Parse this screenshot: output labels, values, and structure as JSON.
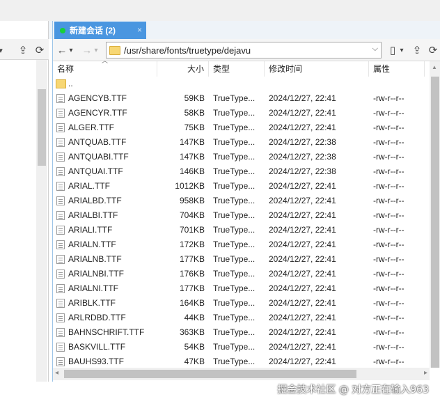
{
  "tab": {
    "label": "新建会话 (2)",
    "close": "×"
  },
  "toolbar": {
    "back": "←",
    "back_dd": "▾",
    "forward": "→",
    "forward_dd": "▾",
    "path": "/usr/share/fonts/truetype/dejavu",
    "bookmark": "▯",
    "up": "⇪",
    "refresh": "⟳"
  },
  "left_toolbar": {
    "item1": "⇪",
    "item2": "⟳"
  },
  "columns": {
    "name": "名称",
    "size": "大小",
    "type": "类型",
    "modified": "修改时间",
    "attrs": "属性"
  },
  "parent": {
    "name": ".."
  },
  "files": [
    {
      "name": "AGENCYB.TTF",
      "size": "59KB",
      "type": "TrueType...",
      "modified": "2024/12/27, 22:41",
      "attrs": "-rw-r--r--"
    },
    {
      "name": "AGENCYR.TTF",
      "size": "58KB",
      "type": "TrueType...",
      "modified": "2024/12/27, 22:41",
      "attrs": "-rw-r--r--"
    },
    {
      "name": "ALGER.TTF",
      "size": "75KB",
      "type": "TrueType...",
      "modified": "2024/12/27, 22:41",
      "attrs": "-rw-r--r--"
    },
    {
      "name": "ANTQUAB.TTF",
      "size": "147KB",
      "type": "TrueType...",
      "modified": "2024/12/27, 22:38",
      "attrs": "-rw-r--r--"
    },
    {
      "name": "ANTQUABI.TTF",
      "size": "147KB",
      "type": "TrueType...",
      "modified": "2024/12/27, 22:38",
      "attrs": "-rw-r--r--"
    },
    {
      "name": "ANTQUAI.TTF",
      "size": "146KB",
      "type": "TrueType...",
      "modified": "2024/12/27, 22:38",
      "attrs": "-rw-r--r--"
    },
    {
      "name": "ARIAL.TTF",
      "size": "1012KB",
      "type": "TrueType...",
      "modified": "2024/12/27, 22:41",
      "attrs": "-rw-r--r--"
    },
    {
      "name": "ARIALBD.TTF",
      "size": "958KB",
      "type": "TrueType...",
      "modified": "2024/12/27, 22:41",
      "attrs": "-rw-r--r--"
    },
    {
      "name": "ARIALBI.TTF",
      "size": "704KB",
      "type": "TrueType...",
      "modified": "2024/12/27, 22:41",
      "attrs": "-rw-r--r--"
    },
    {
      "name": "ARIALI.TTF",
      "size": "701KB",
      "type": "TrueType...",
      "modified": "2024/12/27, 22:41",
      "attrs": "-rw-r--r--"
    },
    {
      "name": "ARIALN.TTF",
      "size": "172KB",
      "type": "TrueType...",
      "modified": "2024/12/27, 22:41",
      "attrs": "-rw-r--r--"
    },
    {
      "name": "ARIALNB.TTF",
      "size": "177KB",
      "type": "TrueType...",
      "modified": "2024/12/27, 22:41",
      "attrs": "-rw-r--r--"
    },
    {
      "name": "ARIALNBI.TTF",
      "size": "176KB",
      "type": "TrueType...",
      "modified": "2024/12/27, 22:41",
      "attrs": "-rw-r--r--"
    },
    {
      "name": "ARIALNI.TTF",
      "size": "177KB",
      "type": "TrueType...",
      "modified": "2024/12/27, 22:41",
      "attrs": "-rw-r--r--"
    },
    {
      "name": "ARIBLK.TTF",
      "size": "164KB",
      "type": "TrueType...",
      "modified": "2024/12/27, 22:41",
      "attrs": "-rw-r--r--"
    },
    {
      "name": "ARLRDBD.TTF",
      "size": "44KB",
      "type": "TrueType...",
      "modified": "2024/12/27, 22:41",
      "attrs": "-rw-r--r--"
    },
    {
      "name": "BAHNSCHRIFT.TTF",
      "size": "363KB",
      "type": "TrueType...",
      "modified": "2024/12/27, 22:41",
      "attrs": "-rw-r--r--"
    },
    {
      "name": "BASKVILL.TTF",
      "size": "54KB",
      "type": "TrueType...",
      "modified": "2024/12/27, 22:41",
      "attrs": "-rw-r--r--"
    },
    {
      "name": "BAUHS93.TTF",
      "size": "47KB",
      "type": "TrueType...",
      "modified": "2024/12/27, 22:41",
      "attrs": "-rw-r--r--"
    }
  ],
  "watermark": "掘金技术社区 @ 对方正在输入963",
  "colors": {
    "tab_active": "#4a96e0",
    "status_dot": "#17d03a",
    "folder": "#f7d774"
  }
}
